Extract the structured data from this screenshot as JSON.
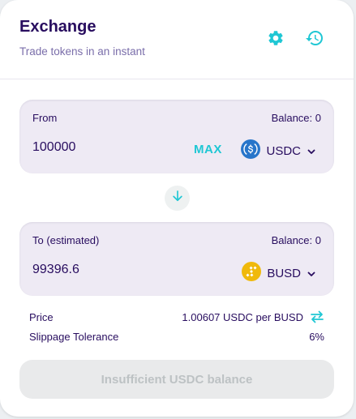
{
  "header": {
    "title": "Exchange",
    "subtitle": "Trade tokens in an instant"
  },
  "from": {
    "label": "From",
    "balance": "Balance: 0",
    "amount": "100000",
    "max_label": "MAX",
    "token": "USDC",
    "token_color": "#2775ca"
  },
  "to": {
    "label": "To (estimated)",
    "balance": "Balance: 0",
    "amount": "99396.6",
    "token": "BUSD",
    "token_color": "#f0b90b"
  },
  "info": {
    "price_label": "Price",
    "price_value": "1.00607 USDC per BUSD",
    "slippage_label": "Slippage Tolerance",
    "slippage_value": "6%"
  },
  "submit": {
    "label": "Insufficient USDC balance"
  },
  "colors": {
    "accent": "#1fc7d4",
    "text_primary": "#280d5f",
    "text_secondary": "#7a6eaa"
  },
  "icons": {
    "settings": "gear-icon",
    "history": "history-icon",
    "swap_direction": "arrow-down-icon",
    "invert_price": "swap-arrows-icon"
  }
}
